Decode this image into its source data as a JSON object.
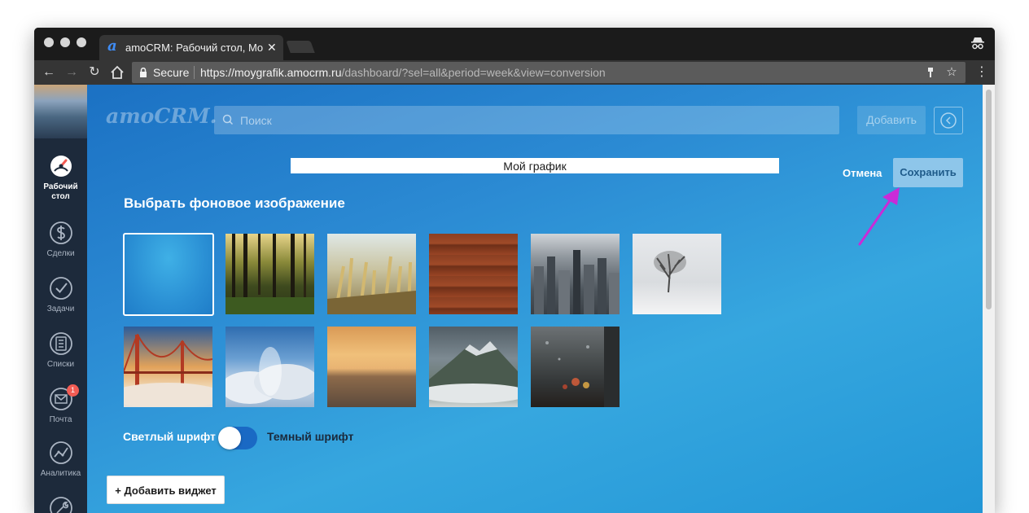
{
  "browser": {
    "tab_title": "amoCRM: Рабочий стол, Мой",
    "tab_close": "✕",
    "tab_logo": "a",
    "secure_label": "Secure",
    "url_host": "https://moygrafik.amocrm.ru",
    "url_path": "/dashboard/?sel=all&period=week&view=conversion",
    "icons": [
      "back-icon",
      "forward-icon",
      "reload-icon",
      "home-icon",
      "lock-icon",
      "key-icon",
      "star-icon",
      "menu-icon",
      "incognito-icon"
    ]
  },
  "sidebar": {
    "items": [
      {
        "label": "Рабочий стол",
        "icon": "dashboard-icon",
        "active": true
      },
      {
        "label": "Сделки",
        "icon": "dollar-icon"
      },
      {
        "label": "Задачи",
        "icon": "check-icon"
      },
      {
        "label": "Списки",
        "icon": "list-icon"
      },
      {
        "label": "Почта",
        "icon": "mail-icon",
        "badge": "1"
      },
      {
        "label": "Аналитика",
        "icon": "analytics-icon"
      },
      {
        "label": "",
        "icon": "settings-icon"
      }
    ]
  },
  "header": {
    "logo": "amoCRM.",
    "search_placeholder": "Поиск",
    "add_label": "Добавить"
  },
  "dashboard": {
    "title_value": "Мой график",
    "cancel_label": "Отмена",
    "save_label": "Сохранить"
  },
  "backgrounds": {
    "title": "Выбрать фоновое изображение",
    "items": [
      "blue-gradient",
      "forest",
      "wheat-field",
      "wood-planks",
      "city-skyline",
      "winter-tree",
      "golden-gate-bridge",
      "clouds",
      "sunset-sea",
      "misty-mountain",
      "rainy-window"
    ],
    "selected": "blue-gradient"
  },
  "font_toggle": {
    "light_label": "Светлый шрифт",
    "dark_label": "Темный шрифт",
    "value": "light"
  },
  "widget": {
    "add_label": "Добавить виджет"
  },
  "colors": {
    "accent": "#1a69c4",
    "annotation_arrow": "#c92bd8",
    "save_button": "#8ec6ea"
  }
}
